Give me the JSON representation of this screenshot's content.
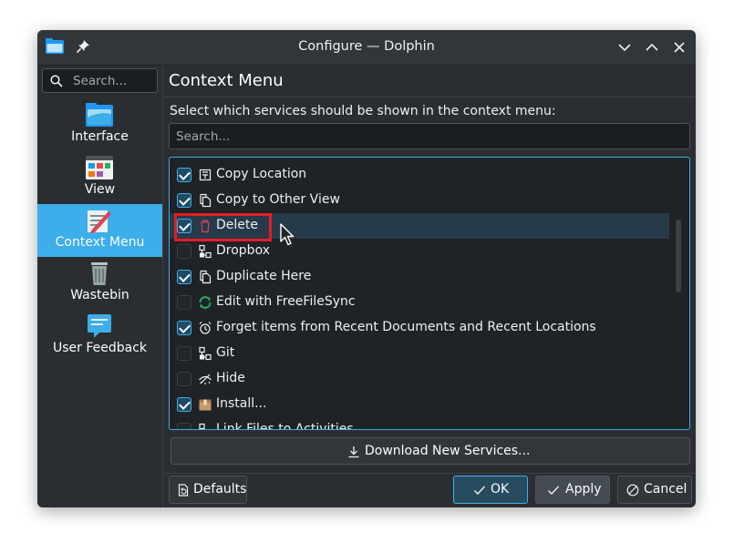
{
  "window": {
    "title": "Configure — Dolphin"
  },
  "sidebar": {
    "search_placeholder": "Search...",
    "items": [
      {
        "label": "Interface",
        "icon": "folder-icon"
      },
      {
        "label": "View",
        "icon": "view-icon"
      },
      {
        "label": "Context Menu",
        "icon": "context-menu-icon",
        "active": true
      },
      {
        "label": "Wastebin",
        "icon": "trash-icon"
      },
      {
        "label": "User Feedback",
        "icon": "feedback-icon"
      }
    ]
  },
  "main": {
    "title": "Context Menu",
    "instruction": "Select which services should be shown in the context menu:",
    "search_placeholder": "Search...",
    "services": [
      {
        "label": "Copy Location",
        "checked": true,
        "icon": "copy-location-icon"
      },
      {
        "label": "Copy to Other View",
        "checked": true,
        "icon": "copy-icon"
      },
      {
        "label": "Delete",
        "checked": true,
        "icon": "delete-icon"
      },
      {
        "label": "Dropbox",
        "checked": false,
        "icon": "network-icon"
      },
      {
        "label": "Duplicate Here",
        "checked": true,
        "icon": "duplicate-icon"
      },
      {
        "label": "Edit with FreeFileSync",
        "checked": false,
        "icon": "sync-icon"
      },
      {
        "label": "Forget items from Recent Documents and Recent Locations",
        "checked": true,
        "icon": "forget-icon"
      },
      {
        "label": "Git",
        "checked": false,
        "icon": "git-icon"
      },
      {
        "label": "Hide",
        "checked": false,
        "icon": "hide-icon"
      },
      {
        "label": "Install...",
        "checked": true,
        "icon": "package-icon"
      },
      {
        "label": "Link Files to Activities",
        "checked": false,
        "icon": "activities-icon"
      }
    ],
    "download_label": "Download New Services..."
  },
  "buttons": {
    "defaults": "Defaults",
    "ok": "OK",
    "apply": "Apply",
    "cancel": "Cancel"
  },
  "colors": {
    "accent": "#3daee9",
    "highlight_box": "#e31e24",
    "window_bg": "#2a2e32"
  }
}
